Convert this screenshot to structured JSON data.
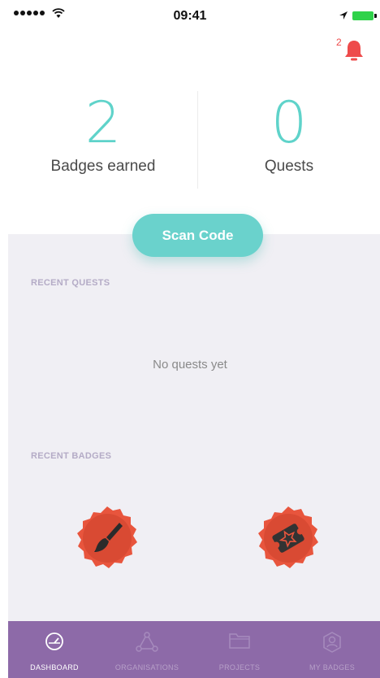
{
  "status_bar": {
    "time": "09:41"
  },
  "notifications": {
    "count": "2",
    "icon": "bell-icon",
    "color": "#ee4b4b"
  },
  "stats": {
    "badges": {
      "value": "2",
      "label": "Badges earned"
    },
    "quests": {
      "value": "0",
      "label": "Quests"
    }
  },
  "scan_button": {
    "label": "Scan Code"
  },
  "recent_quests": {
    "title": "RECENT QUESTS",
    "empty_message": "No quests yet"
  },
  "recent_badges": {
    "title": "RECENT BADGES",
    "items": [
      {
        "icon": "paintbrush-icon"
      },
      {
        "icon": "ticket-star-icon"
      }
    ]
  },
  "tabbar": {
    "items": [
      {
        "label": "DASHBOARD",
        "icon": "dashboard-gauge-icon",
        "active": true
      },
      {
        "label": "ORGANISATIONS",
        "icon": "organisations-icon",
        "active": false
      },
      {
        "label": "PROJECTS",
        "icon": "folder-icon",
        "active": false
      },
      {
        "label": "MY BADGES",
        "icon": "badge-icon",
        "active": false
      }
    ]
  },
  "colors": {
    "accent": "#6ad2cc",
    "stat_number": "#5fd3ca",
    "tabbar": "#8d6aa8",
    "badge": "#e8553d",
    "content_bg": "#f0eff4"
  }
}
